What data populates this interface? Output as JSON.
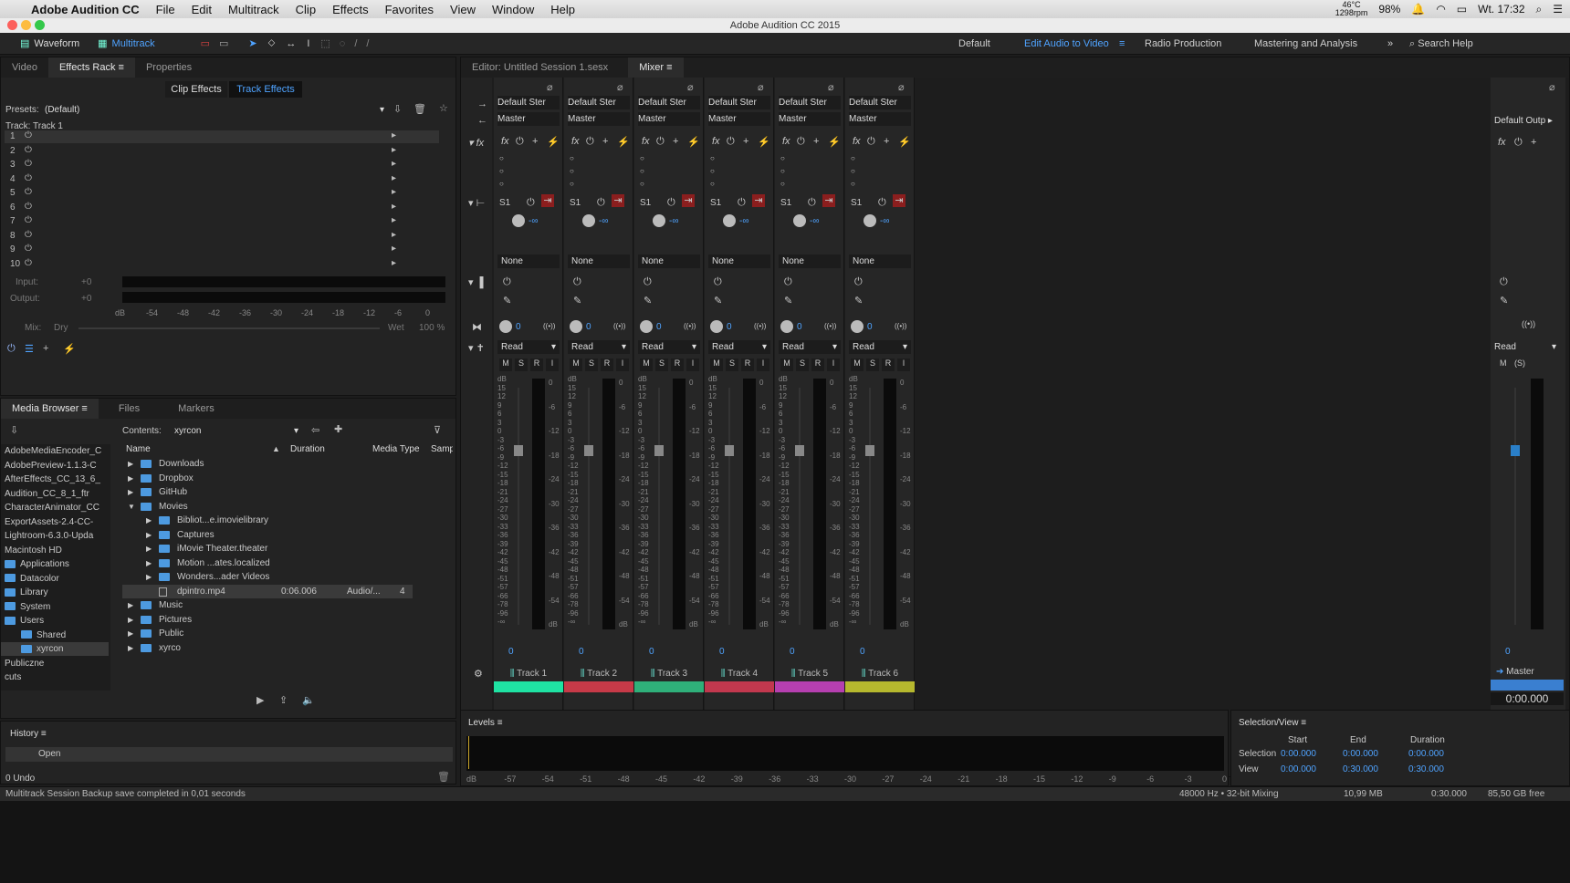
{
  "menubar": {
    "apple": "",
    "app": "Adobe Audition CC",
    "items": [
      "File",
      "Edit",
      "Multitrack",
      "Clip",
      "Effects",
      "Favorites",
      "View",
      "Window",
      "Help"
    ],
    "status": {
      "temp": "46°C",
      "rpm": "1298rpm",
      "battery_pct": "98%",
      "clock": "Wt. 17:32"
    }
  },
  "window": {
    "title": "Adobe Audition CC 2015"
  },
  "toolbar": {
    "waveform": "Waveform",
    "multitrack": "Multitrack",
    "workspaces": [
      "Default",
      "Edit Audio to Video",
      "Radio Production",
      "Mastering and Analysis"
    ],
    "search": "Search Help"
  },
  "effects": {
    "tabs": [
      "Video",
      "Effects Rack",
      "Properties"
    ],
    "subtabs": [
      "Clip Effects",
      "Track Effects"
    ],
    "presets_label": "Presets:",
    "presets_value": "(Default)",
    "track_label": "Track: Track 1",
    "slots": [
      "1",
      "2",
      "3",
      "4",
      "5",
      "6",
      "7",
      "8",
      "9",
      "10"
    ],
    "input_label": "Input:",
    "output_label": "Output:",
    "input_val": "+0",
    "output_val": "+0",
    "scale": [
      "dB",
      "-54",
      "-48",
      "-42",
      "-36",
      "-30",
      "-24",
      "-18",
      "-12",
      "-6",
      "0"
    ],
    "mix_label": "Mix:",
    "dry": "Dry",
    "wet": "Wet",
    "wet_pct": "100 %"
  },
  "media": {
    "tabs": [
      "Media Browser",
      "Files",
      "Markers"
    ],
    "contents_label": "Contents:",
    "contents_value": "xyrcon",
    "columns": [
      "Name",
      "Duration",
      "Media Type",
      "Samp"
    ],
    "left_list": [
      "AdobeMediaEncoder_C",
      "AdobePreview-1.1.3-C",
      "AfterEffects_CC_13_6_",
      "Audition_CC_8_1_ftr",
      "CharacterAnimator_CC",
      "ExportAssets-2.4-CC-",
      "Lightroom-6.3.0-Upda",
      "Macintosh HD",
      "Applications",
      "Datacolor",
      "Library",
      "System",
      "Users",
      "Shared",
      "xyrcon",
      "Publiczne",
      "cuts"
    ],
    "tree": [
      {
        "name": "Downloads",
        "indent": 0,
        "open": false,
        "duration": "",
        "type": ""
      },
      {
        "name": "Dropbox",
        "indent": 0,
        "open": false,
        "duration": "",
        "type": ""
      },
      {
        "name": "GitHub",
        "indent": 0,
        "open": false,
        "duration": "",
        "type": ""
      },
      {
        "name": "Movies",
        "indent": 0,
        "open": true,
        "duration": "",
        "type": ""
      },
      {
        "name": "Bibliot...e.imovielibrary",
        "indent": 1,
        "open": false,
        "duration": "",
        "type": ""
      },
      {
        "name": "Captures",
        "indent": 1,
        "open": false,
        "duration": "",
        "type": ""
      },
      {
        "name": "iMovie Theater.theater",
        "indent": 1,
        "open": false,
        "duration": "",
        "type": ""
      },
      {
        "name": "Motion ...ates.localized",
        "indent": 1,
        "open": false,
        "duration": "",
        "type": ""
      },
      {
        "name": "Wonders...ader Videos",
        "indent": 1,
        "open": false,
        "duration": "",
        "type": ""
      },
      {
        "name": "dpintro.mp4",
        "indent": 1,
        "open": false,
        "duration": "0:06.006",
        "type": "Audio/...",
        "samp": "4"
      },
      {
        "name": "Music",
        "indent": 0,
        "open": false,
        "duration": "",
        "type": ""
      },
      {
        "name": "Pictures",
        "indent": 0,
        "open": false,
        "duration": "",
        "type": ""
      },
      {
        "name": "Public",
        "indent": 0,
        "open": false,
        "duration": "",
        "type": ""
      },
      {
        "name": "xyrco",
        "indent": 0,
        "open": false,
        "duration": "",
        "type": ""
      }
    ]
  },
  "history": {
    "title": "History",
    "items": [
      "Open"
    ],
    "undo": "0 Undo"
  },
  "editor": {
    "tab1": "Editor: Untitled Session 1.sesx",
    "tab2": "Mixer"
  },
  "mixer": {
    "tracks": [
      {
        "name": "Track 1",
        "color": "#1fe3a3",
        "input": "Default Ster",
        "output": "Master",
        "send": "S1",
        "bus": "None",
        "auto": "Read",
        "vol": "0",
        "pan": "0"
      },
      {
        "name": "Track 2",
        "color": "#c73a48",
        "input": "Default Ster",
        "output": "Master",
        "send": "S1",
        "bus": "None",
        "auto": "Read",
        "vol": "0",
        "pan": "0"
      },
      {
        "name": "Track 3",
        "color": "#2fb07a",
        "input": "Default Ster",
        "output": "Master",
        "send": "S1",
        "bus": "None",
        "auto": "Read",
        "vol": "0",
        "pan": "0"
      },
      {
        "name": "Track 4",
        "color": "#c2384e",
        "input": "Default Ster",
        "output": "Master",
        "send": "S1",
        "bus": "None",
        "auto": "Read",
        "vol": "0",
        "pan": "0"
      },
      {
        "name": "Track 5",
        "color": "#b63fb0",
        "input": "Default Ster",
        "output": "Master",
        "send": "S1",
        "bus": "None",
        "auto": "Read",
        "vol": "0",
        "pan": "0"
      },
      {
        "name": "Track 6",
        "color": "#b6b82e",
        "input": "Default Ster",
        "output": "Master",
        "send": "S1",
        "bus": "None",
        "auto": "Read",
        "vol": "0",
        "pan": "0"
      }
    ],
    "master": {
      "name": "Master",
      "output": "Default Outp",
      "auto": "Read",
      "vol": "0",
      "time": "0:00.000",
      "color": "#3a7fd0"
    },
    "fader_scale": [
      "dB",
      "15",
      "12",
      "9",
      "6",
      "3",
      "0",
      "-3",
      "-6",
      "-9",
      "-12",
      "-15",
      "-18",
      "-21",
      "-24",
      "-27",
      "-30",
      "-33",
      "-36",
      "-39",
      "-42",
      "-45",
      "-48",
      "-51",
      "-57",
      "-66",
      "-78",
      "-96",
      "-∞"
    ],
    "meter_scale": [
      "0",
      "-6",
      "-12",
      "-18",
      "-24",
      "-30",
      "-36",
      "-42",
      "-48",
      "-54",
      "dB"
    ],
    "ms": [
      "M",
      "S",
      "R",
      "I"
    ],
    "fx": "fx",
    "inf": "-∞"
  },
  "levels": {
    "title": "Levels",
    "scale": [
      "dB",
      "-57",
      "-54",
      "-51",
      "-48",
      "-45",
      "-42",
      "-39",
      "-36",
      "-33",
      "-30",
      "-27",
      "-24",
      "-21",
      "-18",
      "-15",
      "-12",
      "-9",
      "-6",
      "-3",
      "0"
    ]
  },
  "selection": {
    "title": "Selection/View",
    "cols": [
      "Start",
      "End",
      "Duration"
    ],
    "rows": [
      {
        "label": "Selection",
        "start": "0:00.000",
        "end": "0:00.000",
        "dur": "0:00.000"
      },
      {
        "label": "View",
        "start": "0:00.000",
        "end": "0:30.000",
        "dur": "0:30.000"
      }
    ]
  },
  "status": {
    "msg": "Multitrack Session Backup save completed in 0,01 seconds",
    "rate": "48000 Hz • 32-bit Mixing",
    "size": "10,99 MB",
    "time": "0:30.000",
    "free": "85,50 GB free"
  }
}
